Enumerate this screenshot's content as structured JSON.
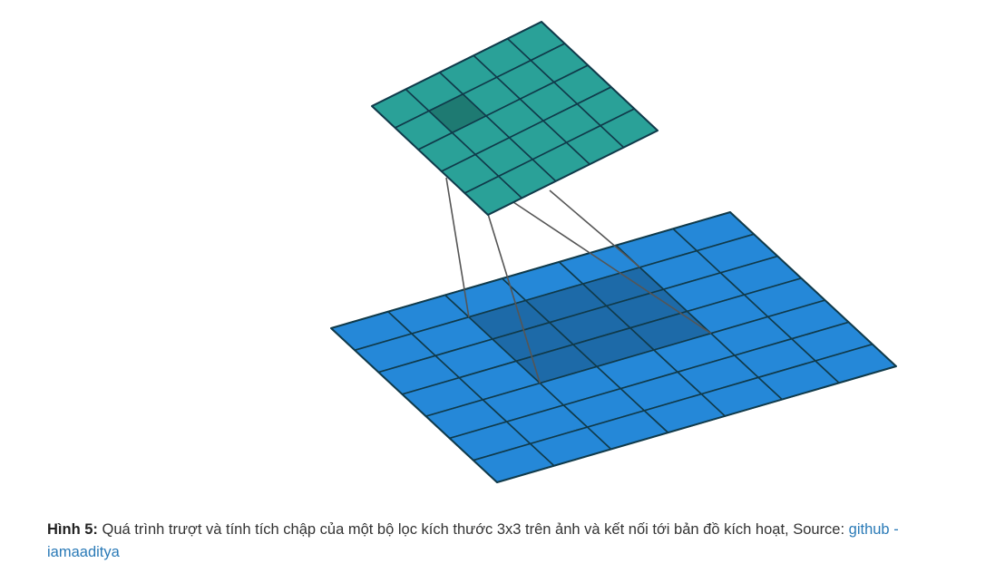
{
  "figure": {
    "output_fill": "#2aa198",
    "output_highlight": "#1e7a72",
    "input_fill": "#2588d8",
    "input_highlight": "#1d6aa8",
    "grid_stroke": "#103a4a",
    "connector_stroke": "#555555",
    "output_grid_size": 5,
    "input_grid_size": 7,
    "filter_size": 3,
    "output_highlight_cell": [
      1,
      1
    ],
    "input_highlight_origin": [
      2,
      1
    ]
  },
  "caption": {
    "label": "Hình 5:",
    "text": " Quá trình trượt và tính tích chập của một bộ lọc kích thước 3x3 trên ảnh và kết nối tới bản đồ kích hoạt, Source: ",
    "link_text": "github - iamaaditya"
  }
}
